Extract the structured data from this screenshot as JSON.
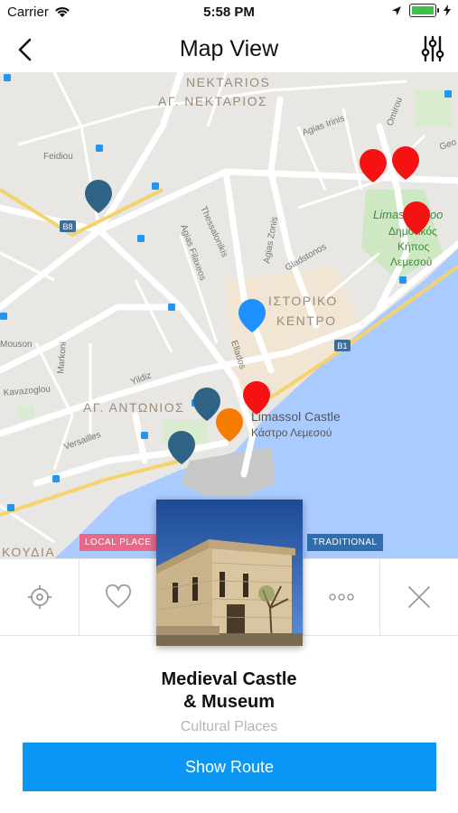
{
  "status_bar": {
    "carrier": "Carrier",
    "time": "5:58 PM"
  },
  "nav": {
    "title": "Map View"
  },
  "map": {
    "labels": {
      "district1_en": "NEKTARIOS",
      "district1_gr": "ΑΓ. ΝΕΚΤΑΡΙΟΣ",
      "historic_gr1": "ΙΣΤΟΡΙΚΟ",
      "historic_gr2": "ΚΕΝΤΡΟ",
      "district2_gr": "ΑΓ. ΑΝΤΩΝΙΟΣ",
      "castle_en": "Limassol Castle",
      "castle_gr": "Κάστρο Λεμεσού",
      "zoo_en": "Limassol Zoo",
      "zoo_gr1": "Δημοτικός",
      "zoo_gr2": "Κήπος",
      "zoo_gr3": "Λεμεσού",
      "koudia": "ΚΟΥΔΙΑ",
      "road_b8": "B8",
      "road_b1": "B1",
      "streets": [
        "Feidiou",
        "Agias Irinis",
        "Omirou",
        "Agias Filaxeos",
        "Thessalonikis",
        "Agias Zonis",
        "Gladstonos",
        "Ellados",
        "Yildiz",
        "Markoni",
        "Mouson",
        "Kavazoglou",
        "Versailles",
        "Geo"
      ]
    }
  },
  "tags": {
    "left": "LOCAL PLACE",
    "right": "TRADITIONAL"
  },
  "actions": [
    "locate-icon",
    "heart-icon",
    "more-icon",
    "close-icon"
  ],
  "place": {
    "title_line1": "Medieval Castle",
    "title_line2": "& Museum",
    "category": "Cultural Places"
  },
  "route_button": {
    "label": "Show Route"
  },
  "colors": {
    "accent": "#0a96f5",
    "pin_red": "#f41212",
    "pin_blue": "#1e90ff",
    "pin_dark": "#2f6385",
    "pin_orange": "#f57c00",
    "sea": "#aacbff",
    "tag_local": "#e8688a",
    "tag_traditional": "#2e6fb0"
  }
}
